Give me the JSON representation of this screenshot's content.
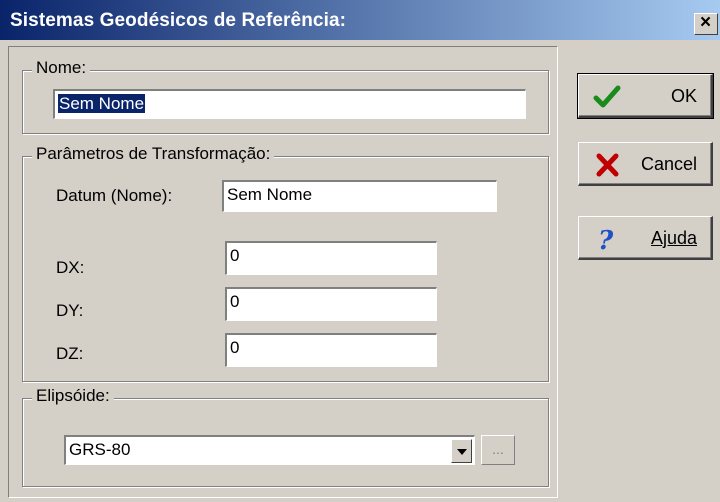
{
  "window": {
    "title": "Sistemas Geodésicos de Referência:",
    "close_glyph": "×"
  },
  "nome_group": {
    "legend": "Nome:",
    "value": "Sem Nome"
  },
  "params_group": {
    "legend": "Parâmetros de Transformação:",
    "datum_label": "Datum (Nome):",
    "datum_value": "Sem Nome",
    "dx_label": "DX:",
    "dx_value": "0",
    "dy_label": "DY:",
    "dy_value": "0",
    "dz_label": "DZ:",
    "dz_value": "0"
  },
  "ellipsoid_group": {
    "legend": "Elipsóide:",
    "selected": "GRS-80",
    "browse_label": "..."
  },
  "buttons": {
    "ok": "OK",
    "cancel": "Cancel",
    "help": "Ajuda"
  },
  "icons": {
    "ok": "checkmark-icon",
    "cancel": "x-icon",
    "help": "question-icon"
  },
  "colors": {
    "title_start": "#0a246a",
    "title_end": "#a6caf0",
    "ok_icon": "#1a8a1a",
    "cancel_icon": "#c00000",
    "help_icon": "#2050c8"
  }
}
